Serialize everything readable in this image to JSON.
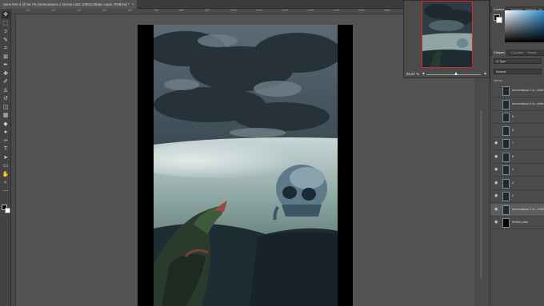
{
  "document": {
    "tab_title": "Sans titre-4 @ 66,7% (tormentasoo 1 format insta 1080x1350px copie, RVB/16) *",
    "close_glyph": "×"
  },
  "ruler": {
    "numbers": [
      "200",
      "300",
      "400",
      "500",
      "600",
      "700",
      "800",
      "900",
      "1000",
      "1100",
      "1200",
      "1300",
      "1400",
      "1500",
      "1600"
    ]
  },
  "toolbar": {
    "tools": [
      {
        "name": "move-tool-icon",
        "glyph": "✥"
      },
      {
        "name": "marquee-tool-icon",
        "glyph": "⬚"
      },
      {
        "name": "lasso-tool-icon",
        "glyph": "ↄ"
      },
      {
        "name": "quick-select-tool-icon",
        "glyph": "✎"
      },
      {
        "name": "crop-tool-icon",
        "glyph": "⌗"
      },
      {
        "name": "frame-tool-icon",
        "glyph": "⊠"
      },
      {
        "name": "eyedropper-tool-icon",
        "glyph": "✒"
      },
      {
        "name": "healing-brush-tool-icon",
        "glyph": "✚"
      },
      {
        "name": "brush-tool-icon",
        "glyph": "✐"
      },
      {
        "name": "clone-stamp-tool-icon",
        "glyph": "♙"
      },
      {
        "name": "history-brush-tool-icon",
        "glyph": "↺"
      },
      {
        "name": "eraser-tool-icon",
        "glyph": "◫"
      },
      {
        "name": "gradient-tool-icon",
        "glyph": "▦"
      },
      {
        "name": "blur-tool-icon",
        "glyph": "◆"
      },
      {
        "name": "dodge-tool-icon",
        "glyph": "●"
      },
      {
        "name": "pen-tool-icon",
        "glyph": "✑"
      },
      {
        "name": "type-tool-icon",
        "glyph": "T"
      },
      {
        "name": "path-select-tool-icon",
        "glyph": "➤"
      },
      {
        "name": "rectangle-tool-icon",
        "glyph": "▭"
      },
      {
        "name": "hand-tool-icon",
        "glyph": "✋"
      },
      {
        "name": "zoom-tool-icon",
        "glyph": "⌕"
      },
      {
        "name": "more-tools-icon",
        "glyph": "⋯"
      }
    ]
  },
  "navigator": {
    "zoom_value": "66,67 %",
    "zoom_fraction": 0.55
  },
  "panels": {
    "color_tabs": [
      "Couleur",
      "Nuancie",
      "Dégradé",
      "Mo"
    ],
    "layers_tabs": [
      "Calques",
      "Couches",
      "Tracés"
    ],
    "filter_label": "Q Type",
    "blend_mode": "Normal",
    "lock_label": "Verrou",
    "layers": [
      {
        "name": "tormentasoo 1 fo...itoile",
        "visible": false,
        "selected": false,
        "thumb": "art"
      },
      {
        "name": "tormentasoo 2 fo...itoile",
        "visible": false,
        "selected": false,
        "thumb": "art"
      },
      {
        "name": "5",
        "visible": false,
        "selected": false,
        "thumb": "art"
      },
      {
        "name": "6",
        "visible": false,
        "selected": false,
        "thumb": "art"
      },
      {
        "name": "7",
        "visible": true,
        "selected": false,
        "thumb": "art"
      },
      {
        "name": "8",
        "visible": true,
        "selected": false,
        "thumb": "art"
      },
      {
        "name": "4",
        "visible": true,
        "selected": false,
        "thumb": "art"
      },
      {
        "name": "3",
        "visible": true,
        "selected": false,
        "thumb": "art"
      },
      {
        "name": "2",
        "visible": true,
        "selected": false,
        "thumb": "art"
      },
      {
        "name": "tormentasoo 1 fo...1080x",
        "visible": true,
        "selected": true,
        "thumb": "art"
      },
      {
        "name": "Arrière-plan",
        "visible": true,
        "selected": false,
        "thumb": "black"
      }
    ]
  },
  "colors": {
    "app_bg": "#535353",
    "panel_bg": "#4b4b4b",
    "navigator_border": "#d12a2a"
  }
}
